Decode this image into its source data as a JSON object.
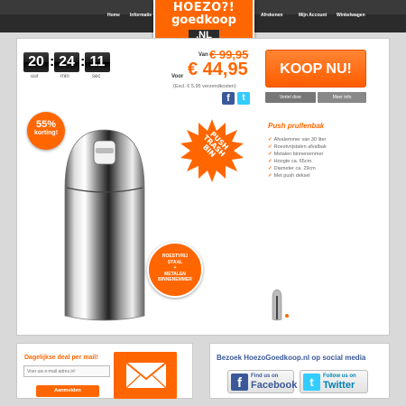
{
  "nav": {
    "items": [
      "Home",
      "Informatie ▾",
      "Afrekenen",
      "Mijn Account",
      "Winkelwagen"
    ]
  },
  "logo": {
    "line1": "HOEZO?!",
    "line2": "goedkoop",
    "line3": ".NL"
  },
  "countdown": {
    "hours": "20",
    "minutes": "24",
    "seconds": "11",
    "labels": [
      "uur",
      "min",
      "sec"
    ]
  },
  "price": {
    "van_label": "Van",
    "old": "€ 99,95",
    "voor_label": "Voor",
    "new": "€ 44,95",
    "shipping_note": "(Excl. € 5,95 verzendkosten)"
  },
  "actions": {
    "buy": "KOOP NU!",
    "share": "Vertel door",
    "more_info": "Meer info"
  },
  "badges": {
    "discount_percent": "55%",
    "discount_label": "korting!",
    "burst": [
      "PUSH",
      "TRASH",
      "BIN"
    ],
    "steel": [
      "ROESTVRIJ",
      "STAAL",
      "+",
      "METALEN",
      "BINNENEMMER"
    ]
  },
  "product": {
    "title": "Push prullenbak",
    "features": [
      "Afvalemmer van 30 liter",
      "Roestvrijstalen afvalbak",
      "Metalen binnenemmer",
      "Hoogte ca. 65cm.",
      "Diameter ca. 29cm",
      "Met push deksel"
    ]
  },
  "newsletter": {
    "title": "Dagelijkse deal per mail!",
    "email_placeholder": "Voer uw e-mail adres in!",
    "button": "Aanmelden"
  },
  "social": {
    "title": "Bezoek HoezoGoedkoop.nl op social media",
    "facebook_top": "Find us on",
    "facebook_main": "Facebook",
    "twitter_top": "Follow us on",
    "twitter_main": "Twitter"
  },
  "colors": {
    "accent": "#ff6600",
    "dark": "#2b2b2b",
    "facebook": "#3b5998",
    "twitter": "#33ccff"
  }
}
